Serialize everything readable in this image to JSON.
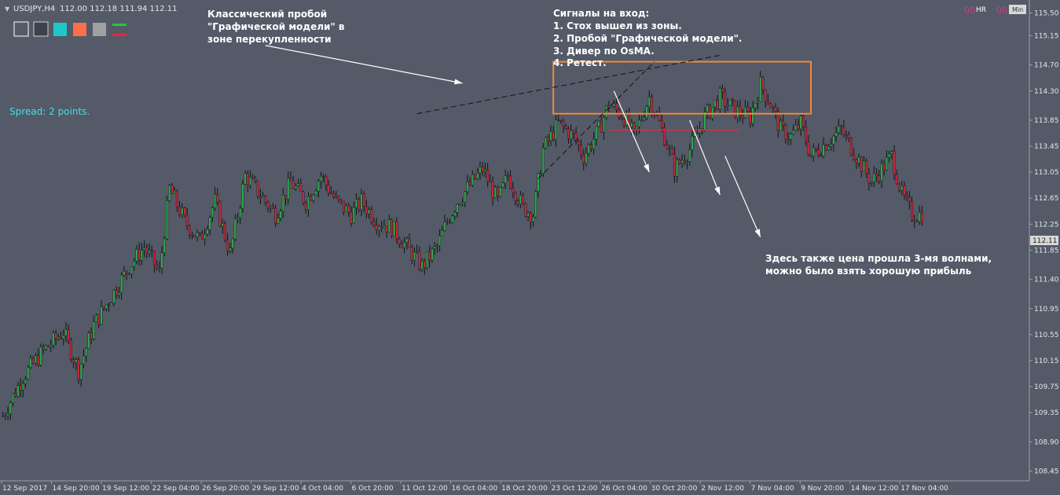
{
  "header": {
    "symbol": "USDJPY,H4",
    "ohlc": "112.00 112.18 111.94 112.11"
  },
  "toolbar": {
    "colors": [
      "#545a68",
      "#3c414b",
      "#1ec8c8",
      "#ff6e4a",
      "#a0a0a0"
    ],
    "line_colors": [
      "#1ecc3c",
      "#e8283c"
    ]
  },
  "top_right": {
    "hr_label": "HR",
    "min_label": "Min",
    "counter_left": "00",
    "counter_right": "00"
  },
  "spread": "Spread: 2 points.",
  "annotations": {
    "left_line1": "Классический пробой",
    "left_line2": "\"Графической модели\" в",
    "left_line3": "зоне перекупленности",
    "signals_title": "Сигналы на вход:",
    "signal_1": "1. Стох вышел из зоны.",
    "signal_2": "2. Пробой \"Графической модели\".",
    "signal_3": "3. Дивер по OsMA.",
    "signal_4": "4. Ретест.",
    "bottom_line1": "Здесь также цена прошла 3-мя волнами,",
    "bottom_line2": "можно было взять хорошую прибыль"
  },
  "colors": {
    "background": "#545a68",
    "text": "#ffffff",
    "bull": "#2fa84a",
    "bear": "#c8283a",
    "zone": "#f08a3c",
    "spread_text": "#3ee0e8",
    "price_tag_bg": "#d8d8d8"
  },
  "chart_data": {
    "type": "candlestick",
    "symbol": "USDJPY",
    "timeframe": "H4",
    "ylim": [
      108.3,
      115.7
    ],
    "y_ticks": [
      "115.50",
      "115.15",
      "114.70",
      "114.30",
      "113.85",
      "113.45",
      "113.05",
      "112.65",
      "112.25",
      "111.85",
      "111.40",
      "110.95",
      "110.55",
      "110.15",
      "109.75",
      "109.35",
      "108.90",
      "108.45"
    ],
    "current_price": "112.11",
    "x_tick_labels": [
      "12 Sep 2017",
      "14 Sep 20:00",
      "19 Sep 12:00",
      "22 Sep 04:00",
      "26 Sep 20:00",
      "29 Sep 12:00",
      "4 Oct 04:00",
      "6 Oct 20:00",
      "11 Oct 12:00",
      "16 Oct 04:00",
      "18 Oct 20:00",
      "23 Oct 12:00",
      "26 Oct 04:00",
      "30 Oct 20:00",
      "2 Nov 12:00",
      "7 Nov 04:00",
      "9 Nov 20:00",
      "14 Nov 12:00",
      "17 Nov 04:00"
    ],
    "close_path": [
      [
        0,
        109.3
      ],
      [
        8,
        109.9
      ],
      [
        16,
        110.3
      ],
      [
        24,
        110.6
      ],
      [
        30,
        110.0
      ],
      [
        36,
        110.7
      ],
      [
        44,
        111.2
      ],
      [
        50,
        111.6
      ],
      [
        56,
        111.9
      ],
      [
        62,
        111.5
      ],
      [
        66,
        112.8
      ],
      [
        72,
        112.3
      ],
      [
        78,
        112.0
      ],
      [
        84,
        112.6
      ],
      [
        90,
        111.8
      ],
      [
        96,
        113.0
      ],
      [
        102,
        112.7
      ],
      [
        108,
        112.4
      ],
      [
        114,
        112.9
      ],
      [
        120,
        112.6
      ],
      [
        126,
        113.0
      ],
      [
        132,
        112.6
      ],
      [
        138,
        112.4
      ],
      [
        142,
        112.6
      ],
      [
        148,
        112.3
      ],
      [
        154,
        112.2
      ],
      [
        160,
        111.9
      ],
      [
        166,
        111.6
      ],
      [
        172,
        111.9
      ],
      [
        176,
        112.3
      ],
      [
        180,
        112.6
      ],
      [
        186,
        112.9
      ],
      [
        190,
        113.1
      ],
      [
        196,
        112.6
      ],
      [
        200,
        113.0
      ],
      [
        206,
        112.5
      ],
      [
        210,
        112.4
      ],
      [
        214,
        113.4
      ],
      [
        220,
        113.8
      ],
      [
        226,
        113.6
      ],
      [
        230,
        113.3
      ],
      [
        236,
        113.7
      ],
      [
        240,
        114.1
      ],
      [
        246,
        113.9
      ],
      [
        250,
        113.6
      ],
      [
        256,
        114.2
      ],
      [
        262,
        113.6
      ],
      [
        266,
        113.1
      ],
      [
        272,
        113.4
      ],
      [
        278,
        113.9
      ],
      [
        284,
        114.2
      ],
      [
        290,
        114.0
      ],
      [
        296,
        113.9
      ],
      [
        300,
        114.4
      ],
      [
        304,
        114.1
      ],
      [
        308,
        113.7
      ],
      [
        312,
        113.6
      ],
      [
        316,
        113.8
      ],
      [
        320,
        113.3
      ],
      [
        326,
        113.5
      ],
      [
        332,
        113.7
      ],
      [
        338,
        113.3
      ],
      [
        344,
        112.9
      ],
      [
        348,
        113.1
      ],
      [
        352,
        113.3
      ],
      [
        356,
        112.7
      ],
      [
        360,
        112.4
      ]
    ],
    "annotation_lines": [
      {
        "name": "upper-trendline",
        "from": [
          164,
          113.95
        ],
        "to": [
          284,
          114.85
        ]
      },
      {
        "name": "lower-trendline",
        "from": [
          212,
          112.95
        ],
        "to": [
          258,
          114.75
        ]
      },
      {
        "name": "retest-level",
        "from": [
          240,
          113.7
        ],
        "to": [
          292,
          113.7
        ]
      },
      {
        "name": "wave-arrow-1",
        "from": [
          242,
          114.3
        ],
        "to": [
          256,
          113.05
        ]
      },
      {
        "name": "wave-arrow-2",
        "from": [
          272,
          113.85
        ],
        "to": [
          284,
          112.7
        ]
      },
      {
        "name": "wave-arrow-3",
        "from": [
          286,
          113.3
        ],
        "to": [
          300,
          112.05
        ]
      },
      {
        "name": "pointer-arrow",
        "from": [
          104,
          115.0
        ],
        "to": [
          182,
          114.42
        ]
      }
    ],
    "zones": [
      {
        "name": "overbought-zone",
        "x": [
          218,
          320
        ],
        "y": [
          113.95,
          114.75
        ]
      }
    ]
  }
}
